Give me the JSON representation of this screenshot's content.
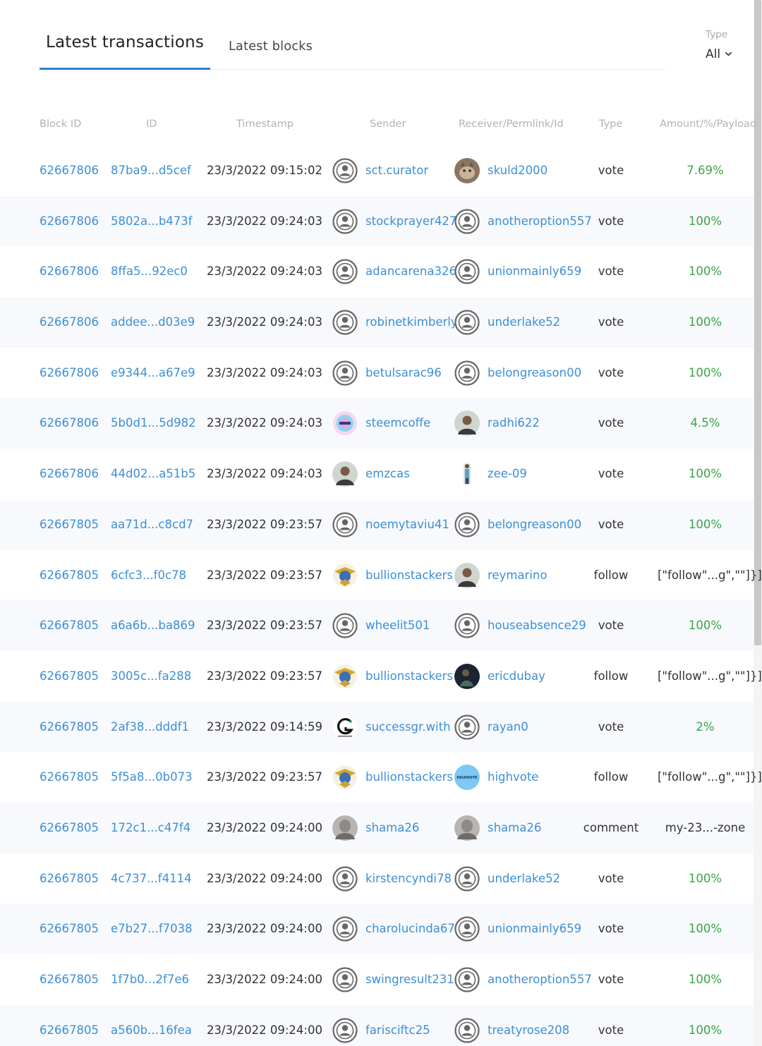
{
  "tabs": {
    "latest_transactions": "Latest transactions",
    "latest_blocks": "Latest blocks"
  },
  "type_filter": {
    "label": "Type",
    "value": "All"
  },
  "columns": {
    "block_id": "Block ID",
    "id": "ID",
    "timestamp": "Timestamp",
    "sender": "Sender",
    "receiver": "Receiver/Permlink/Id",
    "type": "Type",
    "amount": "Amount/%/Payload"
  },
  "colors": {
    "accent": "#2f7ed8",
    "link": "#3d8fd6",
    "positive": "#3aa545",
    "header_text": "#b3b3b3",
    "row_alt": "#f7f9fc"
  },
  "rows": [
    {
      "block": "62667806",
      "id": "87ba9...d5cef",
      "time": "23/3/2022 09:15:02",
      "sender": "sct.curator",
      "sender_avatar": "default-user-icon",
      "receiver": "skuld2000",
      "receiver_avatar": "cat-photo-avatar",
      "type": "vote",
      "amount": "7.69%",
      "amount_style": "green"
    },
    {
      "block": "62667806",
      "id": "5802a...b473f",
      "time": "23/3/2022 09:24:03",
      "sender": "stockprayer427",
      "sender_avatar": "default-user-icon",
      "receiver": "anotheroption557",
      "receiver_avatar": "default-user-icon",
      "type": "vote",
      "amount": "100%",
      "amount_style": "green"
    },
    {
      "block": "62667806",
      "id": "8ffa5...92ec0",
      "time": "23/3/2022 09:24:03",
      "sender": "adancarena326",
      "sender_avatar": "default-user-icon",
      "receiver": "unionmainly659",
      "receiver_avatar": "default-user-icon",
      "type": "vote",
      "amount": "100%",
      "amount_style": "green"
    },
    {
      "block": "62667806",
      "id": "addee...d03e9",
      "time": "23/3/2022 09:24:03",
      "sender": "robinetkimberly",
      "sender_avatar": "default-user-icon",
      "receiver": "underlake52",
      "receiver_avatar": "default-user-icon",
      "type": "vote",
      "amount": "100%",
      "amount_style": "green"
    },
    {
      "block": "62667806",
      "id": "e9344...a67e9",
      "time": "23/3/2022 09:24:03",
      "sender": "betulsarac96",
      "sender_avatar": "default-user-icon",
      "receiver": "belongreason00",
      "receiver_avatar": "default-user-icon",
      "type": "vote",
      "amount": "100%",
      "amount_style": "green"
    },
    {
      "block": "62667806",
      "id": "5b0d1...5d982",
      "time": "23/3/2022 09:24:03",
      "sender": "steemcoffe",
      "sender_avatar": "colorful-logo-avatar",
      "receiver": "radhi622",
      "receiver_avatar": "person-photo-avatar",
      "type": "vote",
      "amount": "4.5%",
      "amount_style": "green"
    },
    {
      "block": "62667806",
      "id": "44d02...a51b5",
      "time": "23/3/2022 09:24:03",
      "sender": "emzcas",
      "sender_avatar": "person-photo-avatar",
      "receiver": "zee-09",
      "receiver_avatar": "standing-person-avatar",
      "type": "vote",
      "amount": "100%",
      "amount_style": "green"
    },
    {
      "block": "62667805",
      "id": "aa71d...c8cd7",
      "time": "23/3/2022 09:23:57",
      "sender": "noemytaviu41",
      "sender_avatar": "default-user-icon",
      "receiver": "belongreason00",
      "receiver_avatar": "default-user-icon",
      "type": "vote",
      "amount": "100%",
      "amount_style": "green"
    },
    {
      "block": "62667805",
      "id": "6cfc3...f0c78",
      "time": "23/3/2022 09:23:57",
      "sender": "bullionstackers",
      "sender_avatar": "eagle-badge-avatar",
      "receiver": "reymarino",
      "receiver_avatar": "person-photo-avatar",
      "type": "follow",
      "amount": "[\"follow\"...g\",\"\"]}]",
      "amount_style": "plain"
    },
    {
      "block": "62667805",
      "id": "a6a6b...ba869",
      "time": "23/3/2022 09:23:57",
      "sender": "wheelit501",
      "sender_avatar": "default-user-icon",
      "receiver": "houseabsence29",
      "receiver_avatar": "default-user-icon",
      "type": "vote",
      "amount": "100%",
      "amount_style": "green"
    },
    {
      "block": "62667805",
      "id": "3005c...fa288",
      "time": "23/3/2022 09:23:57",
      "sender": "bullionstackers",
      "sender_avatar": "eagle-badge-avatar",
      "receiver": "ericdubay",
      "receiver_avatar": "dark-photo-avatar",
      "type": "follow",
      "amount": "[\"follow\"...g\",\"\"]}]",
      "amount_style": "plain"
    },
    {
      "block": "62667805",
      "id": "2af38...dddf1",
      "time": "23/3/2022 09:14:59",
      "sender": "successgr.with",
      "sender_avatar": "letter-g-logo-avatar",
      "receiver": "rayan0",
      "receiver_avatar": "default-user-icon",
      "type": "vote",
      "amount": "2%",
      "amount_style": "green"
    },
    {
      "block": "62667805",
      "id": "5f5a8...0b073",
      "time": "23/3/2022 09:23:57",
      "sender": "bullionstackers",
      "sender_avatar": "eagle-badge-avatar",
      "receiver": "highvote",
      "receiver_avatar": "highvote-logo-avatar",
      "receiver_avatar_text": "HIGHVOTE",
      "type": "follow",
      "amount": "[\"follow\"...g\",\"\"]}]",
      "amount_style": "plain"
    },
    {
      "block": "62667805",
      "id": "172c1...c47f4",
      "time": "23/3/2022 09:24:00",
      "sender": "shama26",
      "sender_avatar": "gray-photo-avatar",
      "receiver": "shama26",
      "receiver_avatar": "gray-photo-avatar",
      "type": "comment",
      "amount": "my-23...-zone",
      "amount_style": "plain"
    },
    {
      "block": "62667805",
      "id": "4c737...f4114",
      "time": "23/3/2022 09:24:00",
      "sender": "kirstencyndi78",
      "sender_avatar": "default-user-icon",
      "receiver": "underlake52",
      "receiver_avatar": "default-user-icon",
      "type": "vote",
      "amount": "100%",
      "amount_style": "green"
    },
    {
      "block": "62667805",
      "id": "e7b27...f7038",
      "time": "23/3/2022 09:24:00",
      "sender": "charolucinda67",
      "sender_avatar": "default-user-icon",
      "receiver": "unionmainly659",
      "receiver_avatar": "default-user-icon",
      "type": "vote",
      "amount": "100%",
      "amount_style": "green"
    },
    {
      "block": "62667805",
      "id": "1f7b0...2f7e6",
      "time": "23/3/2022 09:24:00",
      "sender": "swingresult231",
      "sender_avatar": "default-user-icon",
      "receiver": "anotheroption557",
      "receiver_avatar": "default-user-icon",
      "type": "vote",
      "amount": "100%",
      "amount_style": "green"
    },
    {
      "block": "62667805",
      "id": "a560b...16fea",
      "time": "23/3/2022 09:24:00",
      "sender": "farisciftc25",
      "sender_avatar": "default-user-icon",
      "receiver": "treatyrose208",
      "receiver_avatar": "default-user-icon",
      "type": "vote",
      "amount": "100%",
      "amount_style": "green"
    }
  ]
}
